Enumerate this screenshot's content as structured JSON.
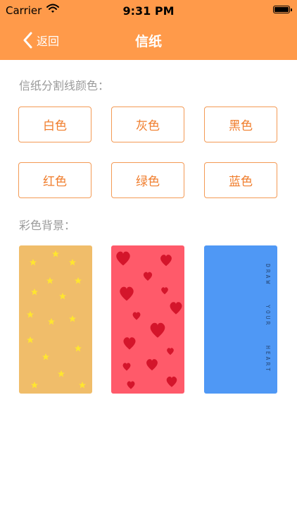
{
  "status_bar": {
    "carrier": "Carrier",
    "time": "9:31 PM"
  },
  "nav": {
    "back_label": "返回",
    "title": "信纸"
  },
  "divider_section": {
    "label": "信纸分割线颜色：",
    "options": [
      "白色",
      "灰色",
      "黑色",
      "红色",
      "绿色",
      "蓝色"
    ]
  },
  "background_section": {
    "label": "彩色背景：",
    "cards": [
      {
        "name": "stars",
        "color": "#f0bd6a"
      },
      {
        "name": "hearts",
        "color": "#ff5a6a"
      },
      {
        "name": "draw-your-heart",
        "color": "#4f98f5",
        "text": [
          "DRAW",
          "YOUR",
          "HEART"
        ]
      }
    ]
  },
  "colors": {
    "accent": "#ff9a4a",
    "button_border": "#f39a55",
    "button_text": "#f07d2c"
  }
}
